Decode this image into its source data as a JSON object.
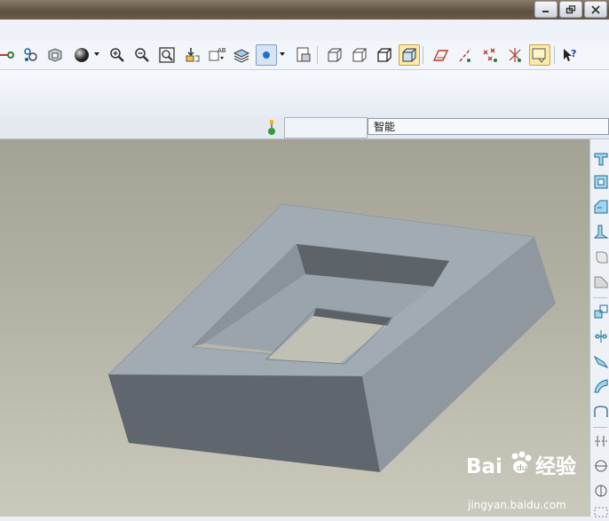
{
  "window": {
    "controls": [
      "minimize-icon",
      "restore-icon",
      "close-icon"
    ]
  },
  "toolbar": {
    "buttons": [
      "datum-display-icon",
      "spin-center-icon",
      "view-manager-icon",
      "appearance-gallery-icon",
      "zoom-in-icon",
      "zoom-out-icon",
      "refit-icon",
      "reorient-icon",
      "saved-views-icon",
      "layers-icon",
      "display-style-icon",
      "annotations-icon",
      "wireframe-icon",
      "hidden-line-icon",
      "no-hidden-icon",
      "shading-icon",
      "datum-planes-icon",
      "datum-axes-icon",
      "datum-points-icon",
      "coordinate-systems-icon",
      "select-filter-icon",
      "context-help-icon"
    ]
  },
  "status": {
    "filter_value": "智能"
  },
  "right_toolbar": {
    "buttons": [
      "extrude-icon",
      "hole-icon",
      "shell-icon",
      "rib-icon",
      "draft-icon",
      "round-icon",
      "chamfer-icon",
      "pattern-icon",
      "mirror-icon",
      "blend-icon",
      "sweep-icon",
      "datum-plane-icon",
      "datum-axis-icon",
      "datum-point-icon"
    ]
  },
  "viewport": {
    "model_name": "rectangular-block-with-pocket",
    "colors": {
      "top": "#a1abb3",
      "front": "#5f666d",
      "right": "#8f989f",
      "pocket_wall": "#5c6369",
      "background": "#b2b0a3"
    }
  },
  "watermark": {
    "brand": "Bai",
    "brand2": "经验",
    "url": "jingyan.baidu.com"
  }
}
